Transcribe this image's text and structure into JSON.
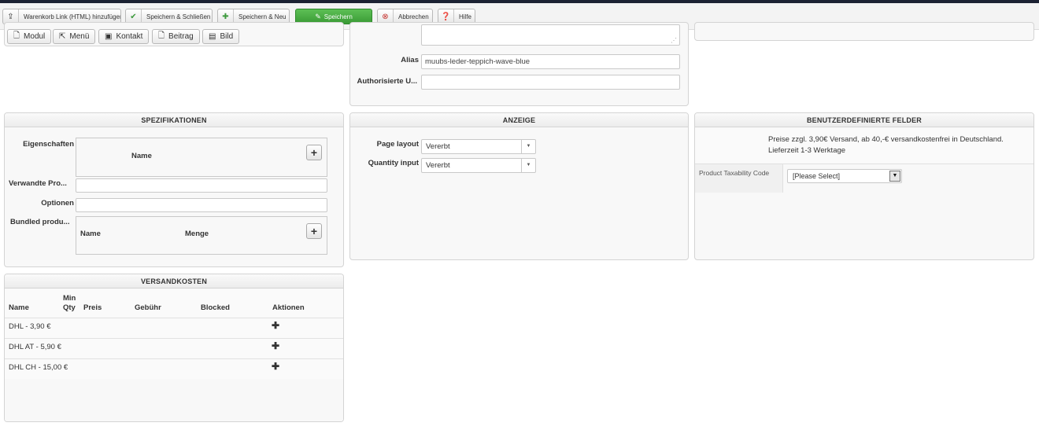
{
  "toolbar": {
    "buttons": [
      {
        "icon": "upload-icon",
        "label": "Warenkorb Link (HTML) hinzufügen"
      },
      {
        "icon": "check-icon",
        "label": "Speichern & Schließen"
      },
      {
        "icon": "plus-icon",
        "label": "Speichern & Neu"
      },
      {
        "icon": "edit-icon",
        "label": "Speichern"
      },
      {
        "icon": "cancel-icon",
        "label": "Abbrechen"
      },
      {
        "icon": "help-icon",
        "label": "Hilfe"
      }
    ]
  },
  "editor": {
    "buttons": [
      "Modul",
      "Menü",
      "Kontakt",
      "Beitrag",
      "Bild"
    ]
  },
  "details": {
    "alias_label": "Alias",
    "alias_value": "muubs-leder-teppich-wave-blue",
    "authorised_label": "Authorisierte U...",
    "authorised_value": ""
  },
  "spezifikationen": {
    "title": "SPEZIFIKATIONEN",
    "eigenschaften_label": "Eigenschaften",
    "eigenschaften_col": "Name",
    "verwandte_label": "Verwandte Pro...",
    "optionen_label": "Optionen",
    "bundled_label": "Bundled produ...",
    "bundled_col_name": "Name",
    "bundled_col_menge": "Menge"
  },
  "anzeige": {
    "title": "ANZEIGE",
    "page_layout_label": "Page layout",
    "page_layout_value": "Vererbt",
    "quantity_input_label": "Quantity input",
    "quantity_input_value": "Vererbt"
  },
  "benutzer": {
    "title": "BENUTZERDEFINIERTE FELDER",
    "note_line1": "Preise zzgl. 3,90€ Versand, ab 40,-€ versandkostenfrei in Deutschland.",
    "note_line2": "Lieferzeit 1-3 Werktage",
    "tax_label": "Product Taxability Code",
    "tax_value": "[Please Select]"
  },
  "versand": {
    "title": "VERSANDKOSTEN",
    "headers": {
      "name": "Name",
      "min1": "Min",
      "min2": "Qty",
      "preis": "Preis",
      "gebuehr": "Gebühr",
      "blocked": "Blocked",
      "aktionen": "Aktionen"
    },
    "rows": [
      {
        "name": "DHL - 3,90 €"
      },
      {
        "name": "DHL AT - 5,90 €"
      },
      {
        "name": "DHL CH - 15,00 €"
      }
    ]
  }
}
